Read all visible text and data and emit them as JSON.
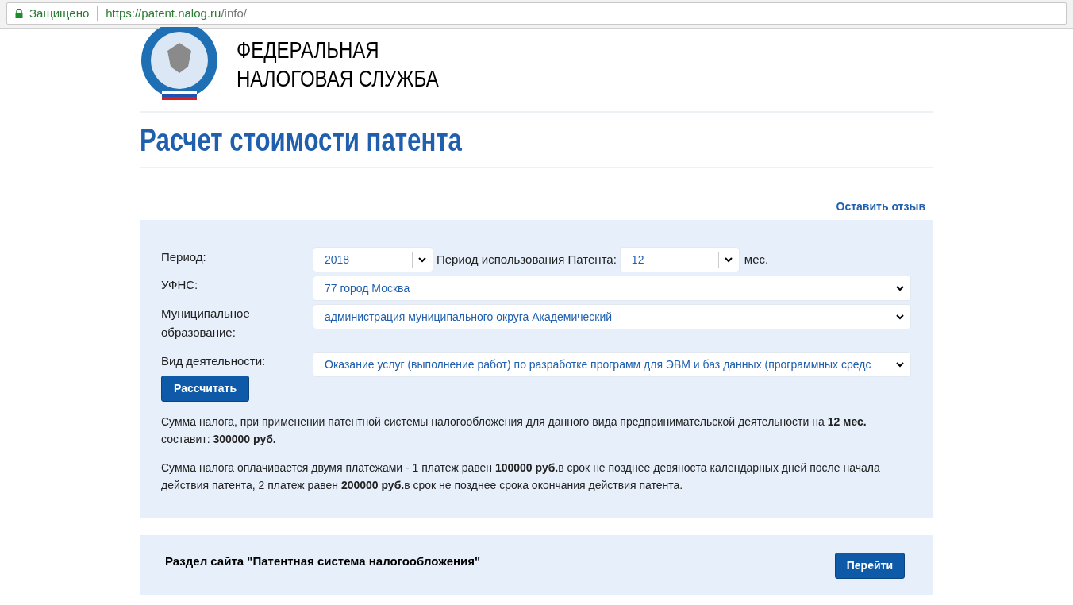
{
  "browser": {
    "secure_label": "Защищено",
    "url_host": "https://patent.nalog.ru",
    "url_path": "/info/"
  },
  "header": {
    "org_lines": [
      "ФЕДЕРАЛЬНАЯ",
      "НАЛОГОВАЯ СЛУЖБА"
    ]
  },
  "page_title": "Расчет стоимости патента",
  "feedback_link": "Оставить отзыв",
  "form": {
    "period": {
      "label": "Период:",
      "value": "2018"
    },
    "patent_period": {
      "label": "Период использования Патента:",
      "value": "12",
      "unit": "мес."
    },
    "fields": [
      {
        "label": "УФНС:",
        "value": "77 город Москва"
      },
      {
        "label": "Муниципальное образование:",
        "value": "администрация муниципального округа Академический"
      },
      {
        "label": "Вид деятельности:",
        "value": "Оказание услуг (выполнение работ) по разработке программ для ЭВМ и баз данных (программных средс"
      }
    ],
    "submit": "Рассчитать",
    "results": [
      "Сумма налога, при применении патентной системы налогообложения для данного вида предпринимательской деятельности на **12 мес.** составит: **300000 руб.**",
      "Сумма налога оплачивается двумя платежами - 1 платеж равен **100000 руб.**в срок не позднее девяноста календарных дней после начала действия патента, 2 платеж равен **200000 руб.**в срок не позднее срока окончания действия патента."
    ]
  },
  "section_link": {
    "text": "Раздел сайта \"Патентная система налогообложения\"",
    "button": "Перейти"
  }
}
